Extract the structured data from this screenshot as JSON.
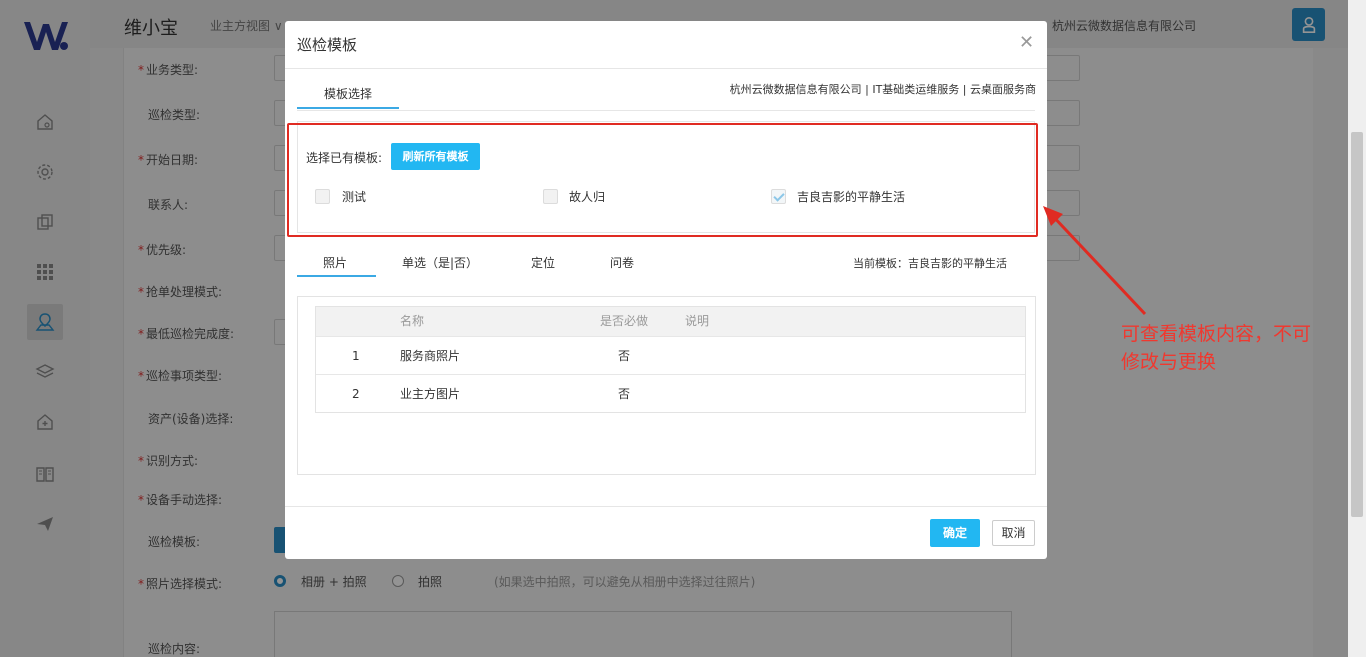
{
  "app": {
    "brand": "维小宝",
    "nav_owner_view": "业主方视图 ∨",
    "company": "杭州云微数据信息有限公司"
  },
  "sidebar": {
    "icons": [
      "home-icon",
      "gear-icon",
      "copy-icon",
      "grid-icon",
      "map-pin-icon",
      "layers-icon",
      "house-plus-icon",
      "book-icon",
      "send-icon"
    ],
    "active_index": 4
  },
  "form": {
    "labels": [
      {
        "text": "业务类型:",
        "required": true
      },
      {
        "text": "巡检类型:",
        "required": false
      },
      {
        "text": "开始日期:",
        "required": true
      },
      {
        "text": "联系人:",
        "required": false
      },
      {
        "text": "优先级:",
        "required": true
      },
      {
        "text": "抢单处理模式:",
        "required": true
      },
      {
        "text": "最低巡检完成度:",
        "required": true
      },
      {
        "text": "巡检事项类型:",
        "required": true
      },
      {
        "text": "资产(设备)选择:",
        "required": false
      },
      {
        "text": "识别方式:",
        "required": true
      },
      {
        "text": "设备手动选择:",
        "required": true
      },
      {
        "text": "巡检模板:",
        "required": false
      },
      {
        "text": "照片选择模式:",
        "required": true
      },
      {
        "text": "巡检内容:",
        "required": false
      }
    ],
    "photo_mode_option1": "相册 + 拍照",
    "photo_mode_option2": "拍照",
    "photo_mode_hint": "(如果选中拍照，可以避免从相册中选择过往照片)"
  },
  "dialog": {
    "title": "巡检模板",
    "tab_label": "模板选择",
    "crumb": "杭州云微数据信息有限公司 | IT基础类运维服务 | 云桌面服务商",
    "choose_label": "选择已有模板:",
    "refresh_label": "刷新所有模板",
    "templates": [
      {
        "name": "测试",
        "checked": false
      },
      {
        "name": "故人归",
        "checked": false
      },
      {
        "name": "吉良吉影的平静生活",
        "checked": true
      }
    ],
    "detail_tabs": [
      "照片",
      "单选（是|否）",
      "定位",
      "问卷"
    ],
    "current_template": "当前模板：吉良吉影的平静生活",
    "table": {
      "headers": [
        "",
        "名称",
        "是否必做",
        "说明"
      ],
      "rows": [
        [
          "1",
          "服务商照片",
          "否",
          ""
        ],
        [
          "2",
          "业主方图片",
          "否",
          ""
        ]
      ]
    },
    "ok_label": "确定",
    "cancel_label": "取消"
  },
  "annotation": {
    "note_line1": "可查看模板内容，不可",
    "note_line2": "修改与更换",
    "color": "#f0382f"
  }
}
